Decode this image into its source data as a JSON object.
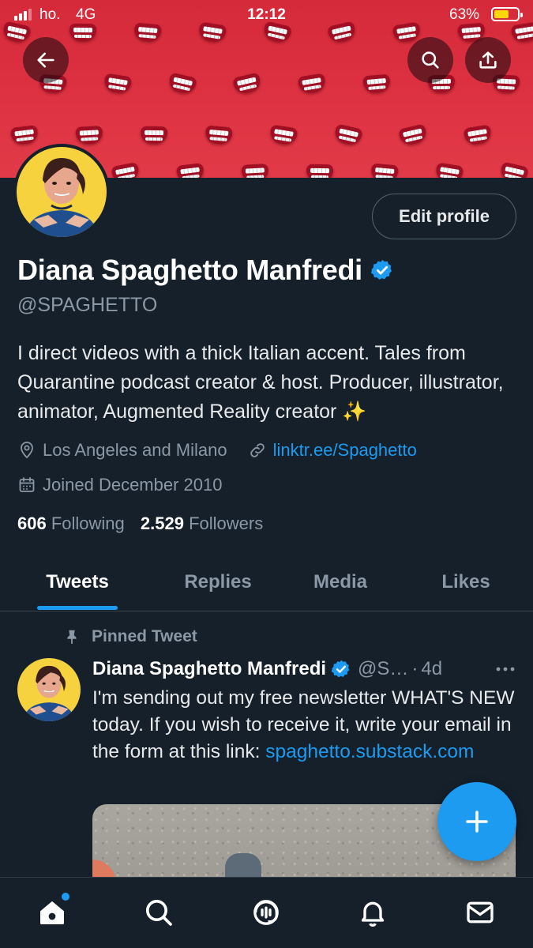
{
  "status_bar": {
    "carrier": "ho.",
    "network": "4G",
    "time": "12:12",
    "battery_percent": "63%",
    "battery_level": 0.63,
    "battery_color": "#ffd60a"
  },
  "header": {
    "back_icon": "arrow-left-icon",
    "search_icon": "search-icon",
    "share_icon": "share-icon"
  },
  "profile": {
    "edit_label": "Edit profile",
    "display_name": "Diana Spaghetto Manfredi",
    "handle": "@SPAGHETTO",
    "bio": "I direct videos with a thick Italian accent. Tales from Quarantine podcast creator & host. Producer, illustrator, animator, Augmented Reality creator ✨",
    "location": "Los Angeles and Milano",
    "website": "linktr.ee/Spaghetto",
    "joined": "Joined December 2010",
    "following_count": "606",
    "following_label": "Following",
    "followers_count": "2.529",
    "followers_label": "Followers"
  },
  "tabs": [
    {
      "label": "Tweets",
      "active": true
    },
    {
      "label": "Replies",
      "active": false
    },
    {
      "label": "Media",
      "active": false
    },
    {
      "label": "Likes",
      "active": false
    }
  ],
  "pinned_tweet": {
    "pinned_label": "Pinned Tweet",
    "author_name": "Diana Spaghetto Manfredi",
    "author_handle": "@S…",
    "separator": "·",
    "time": "4d",
    "text": "I'm sending out my free newsletter WHAT'S NEW today. If you wish to receive it, write your email in the form at this link: ",
    "link": "spaghetto.substack.com"
  },
  "fab": {
    "icon": "plus-icon"
  },
  "bottom_nav": [
    {
      "icon": "home-icon",
      "active": true
    },
    {
      "icon": "search-icon",
      "active": false
    },
    {
      "icon": "spaces-icon",
      "active": false
    },
    {
      "icon": "bell-icon",
      "active": false
    },
    {
      "icon": "mail-icon",
      "active": false
    }
  ],
  "colors": {
    "background": "#15202b",
    "accent": "#1d9bf0",
    "secondary_text": "#8b98a5",
    "banner": "#d52a3a"
  }
}
